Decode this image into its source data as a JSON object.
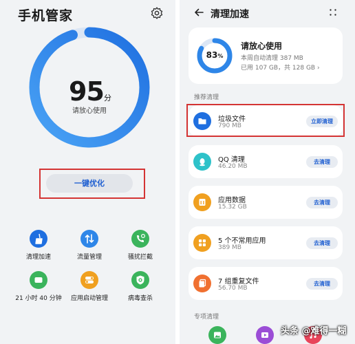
{
  "left": {
    "title": "手机管家",
    "score": "95",
    "score_unit": "分",
    "score_caption": "请放心使用",
    "score_progress": 0.95,
    "optimize_button": "一键优化",
    "tools": [
      {
        "label": "清理加速",
        "color": "#1f6fe0"
      },
      {
        "label": "流量管理",
        "color": "#2e86e8"
      },
      {
        "label": "骚扰拦截",
        "color": "#3bb45c"
      },
      {
        "label": "21 小时 40 分钟",
        "color": "#3bb45c"
      },
      {
        "label": "应用启动管理",
        "color": "#f0a020"
      },
      {
        "label": "病毒查杀",
        "color": "#3bb45c"
      }
    ]
  },
  "right": {
    "title": "清理加速",
    "summary": {
      "percent": "83",
      "percent_unit": "%",
      "percent_value": 0.83,
      "title": "请放心使用",
      "weekly_auto_clean": "本周自动清理 387 MB",
      "storage": "已用 107 GB，共 128 GB"
    },
    "section_recommended": "推荐清理",
    "items": [
      {
        "name": "垃圾文件",
        "size": "790 MB",
        "button": "立即清理",
        "color": "#1f6fe0"
      },
      {
        "name": "QQ 清理",
        "size": "46.20 MB",
        "button": "去清理",
        "color": "#2ec2c9"
      },
      {
        "name": "应用数据",
        "size": "15.32 GB",
        "button": "去清理",
        "color": "#f0a020"
      },
      {
        "name": "5 个不常用应用",
        "size": "389 MB",
        "button": "去清理",
        "color": "#f0a020"
      },
      {
        "name": "7 组重复文件",
        "size": "56.70 MB",
        "button": "去清理",
        "color": "#f07030"
      }
    ],
    "section_special": "专项清理"
  },
  "watermark": "头条 @难得一糊",
  "colors": {
    "accent_blue": "#1f5fd1",
    "ring_blue": "#2e86e8",
    "highlight_red": "#d43333",
    "background": "#f1f3f5"
  }
}
